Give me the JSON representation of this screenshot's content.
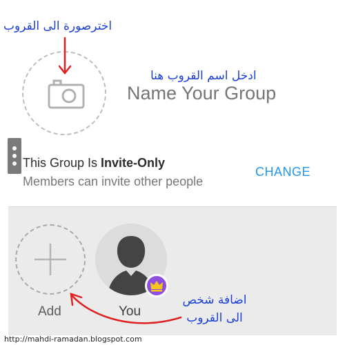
{
  "annotations": {
    "photo_hint": "اخترصورة الى القروب",
    "name_hint": "ادخل اسم القروب هنا",
    "add_hint_line1": "اضافة شخص",
    "add_hint_line2": "الى القروب"
  },
  "group_form": {
    "name_placeholder": "Name Your Group",
    "invite_title_prefix": "This Group Is ",
    "invite_title_bold": "Invite-Only",
    "invite_subtitle": "Members can invite other people",
    "change_label": "CHANGE"
  },
  "members": {
    "add_label": "Add",
    "you_label": "You"
  },
  "footer": {
    "url": "http://mahdi-ramadan.blogspot.com"
  },
  "colors": {
    "accent": "#2196f3",
    "annotation_text": "#1a3fd6",
    "arrow": "#e02020",
    "badge": "#8e4ee0",
    "crown": "#f5c518"
  }
}
